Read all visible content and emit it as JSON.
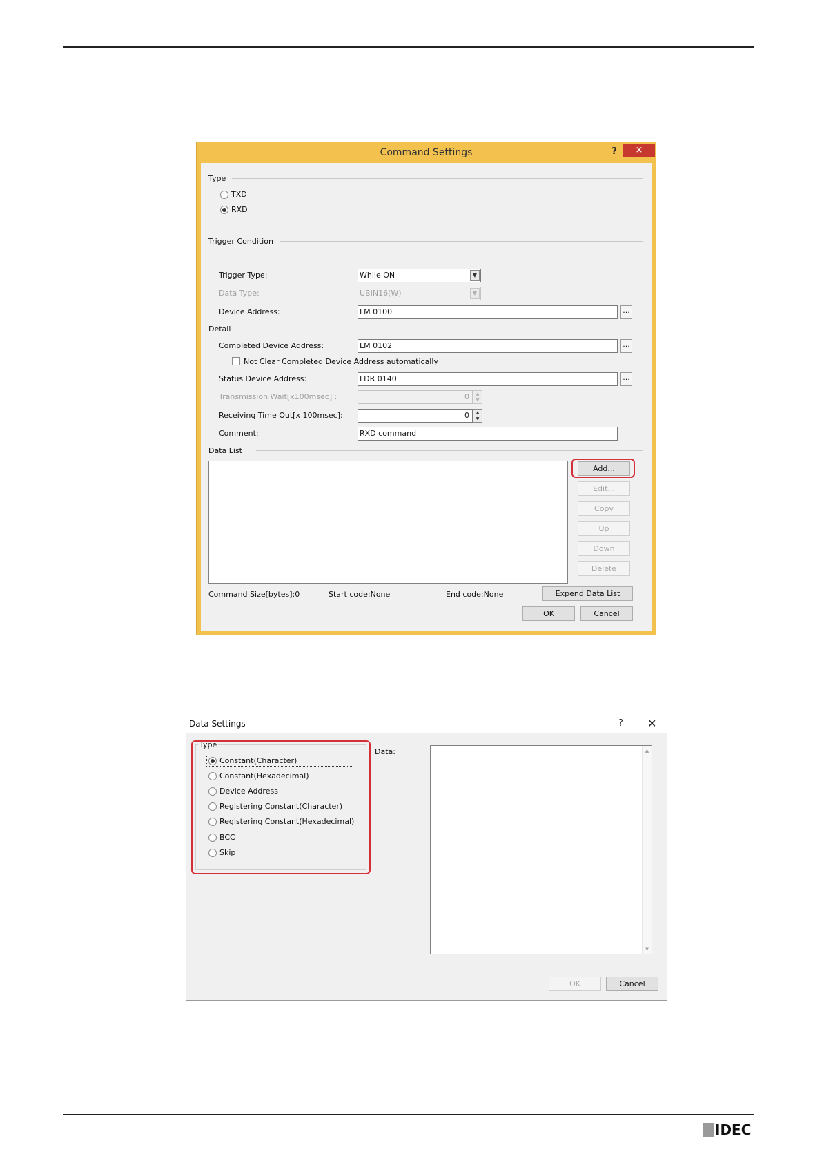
{
  "command_settings": {
    "title": "Command Settings",
    "help_label": "?",
    "close_label": "×",
    "type_group": "Type",
    "type_options": [
      "TXD",
      "RXD"
    ],
    "trigger_group": "Trigger Condition",
    "trigger_type_label": "Trigger Type:",
    "trigger_type_value": "While ON",
    "data_type_label": "Data Type:",
    "data_type_value": "UBIN16(W)",
    "device_address_label": "Device Address:",
    "device_address_value": "LM 0100",
    "detail_group": "Detail",
    "completed_label": "Completed Device Address:",
    "completed_value": "LM 0102",
    "not_clear_label": "Not Clear Completed Device Address automatically",
    "status_label": "Status Device Address:",
    "status_value": "LDR 0140",
    "transmission_label": "Transmission Wait[x100msec] :",
    "transmission_value": "0",
    "receiving_label": "Receiving Time Out[x 100msec]:",
    "receiving_value": "0",
    "comment_label": "Comment:",
    "comment_value": "RXD command",
    "data_list_group": "Data List",
    "buttons": [
      "Add...",
      "Edit...",
      "Copy",
      "Up",
      "Down",
      "Delete"
    ],
    "command_size": "Command Size[bytes]:0",
    "start_code": "Start code:None",
    "end_code": "End code:None",
    "expend_label": "Expend Data List",
    "ok_label": "OK",
    "cancel_label": "Cancel",
    "ellipsis": "..."
  },
  "data_settings": {
    "title": "Data Settings",
    "help_label": "?",
    "close_label": "✕",
    "type_group": "Type",
    "type_options": [
      "Constant(Character)",
      "Constant(Hexadecimal)",
      "Device Address",
      "Registering Constant(Character)",
      "Registering Constant(Hexadecimal)",
      "BCC",
      "Skip"
    ],
    "data_label": "Data:",
    "ok_label": "OK",
    "cancel_label": "Cancel"
  },
  "footer": {
    "logo": "IDEC"
  },
  "colors": {
    "title_bar": "#f3c24e",
    "close_button": "#c7392f",
    "highlight": "#d4303a"
  }
}
